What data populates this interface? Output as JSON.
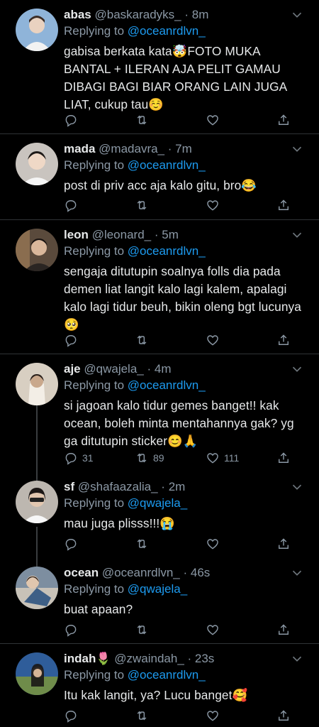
{
  "tweets": [
    {
      "name": "abas",
      "handle": "@baskaradyks_",
      "time": "8m",
      "replying_prefix": "Replying to",
      "replying_to": "@oceanrdlvn_",
      "text": "gabisa berkata kata🤯FOTO MUKA BANTAL + ILERAN AJA PELIT GAMAU DIBAGI BAGI BIAR ORANG LAIN JUGA LIAT, cukup tau☺️",
      "reply_count": "",
      "retweet_count": "",
      "like_count": "",
      "avatar_color": "#8fb4d9"
    },
    {
      "name": "mada",
      "handle": "@madavra_",
      "time": "7m",
      "replying_prefix": "Replying to",
      "replying_to": "@oceanrdlvn_",
      "text": "post di priv acc aja kalo gitu, bro😂",
      "reply_count": "",
      "retweet_count": "",
      "like_count": "",
      "avatar_color": "#c9c4bf"
    },
    {
      "name": "leon",
      "handle": "@leonard_",
      "time": "5m",
      "replying_prefix": "Replying to",
      "replying_to": "@oceanrdlvn_",
      "text": "sengaja ditutupin soalnya folls dia pada demen liat langit kalo lagi kalem, apalagi kalo lagi tidur beuh, bikin oleng bgt lucunya🥺",
      "reply_count": "",
      "retweet_count": "",
      "like_count": "",
      "avatar_color": "#5a4a3c"
    },
    {
      "name": "aje",
      "handle": "@qwajela_",
      "time": "4m",
      "replying_prefix": "Replying to",
      "replying_to": "@oceanrdlvn_",
      "text": "si jagoan kalo tidur gemes banget!! kak ocean, boleh minta mentahannya gak? yg ga ditutupin sticker😊🙏",
      "reply_count": "31",
      "retweet_count": "89",
      "like_count": "111",
      "avatar_color": "#d8cfc2"
    },
    {
      "name": "sf",
      "handle": "@shafaazalia_",
      "time": "2m",
      "replying_prefix": "Replying to",
      "replying_to": "@qwajela_",
      "text": "mau juga plisss!!!😭",
      "reply_count": "",
      "retweet_count": "",
      "like_count": "",
      "avatar_color": "#bdb7b0"
    },
    {
      "name": "ocean",
      "handle": "@oceanrdlvn_",
      "time": "46s",
      "replying_prefix": "Replying to",
      "replying_to": "@qwajela_",
      "text": "buat apaan?",
      "reply_count": "",
      "retweet_count": "",
      "like_count": "",
      "avatar_color": "#7d8ea0"
    },
    {
      "name": "indah🌷",
      "handle": "@zwaindah_",
      "time": "23s",
      "replying_prefix": "Replying to",
      "replying_to": "@oceanrdlvn_",
      "text": "Itu kak langit, ya? Lucu banget🥰",
      "reply_count": "",
      "retweet_count": "",
      "like_count": "",
      "avatar_color": "#2f5d9a"
    }
  ],
  "icons": {
    "reply": "reply-icon",
    "retweet": "retweet-icon",
    "like": "like-icon",
    "share": "share-icon",
    "more": "chevron-down-icon"
  },
  "colors": {
    "background": "#000000",
    "mention": "#1d9bf0",
    "muted": "#8b98a5"
  }
}
